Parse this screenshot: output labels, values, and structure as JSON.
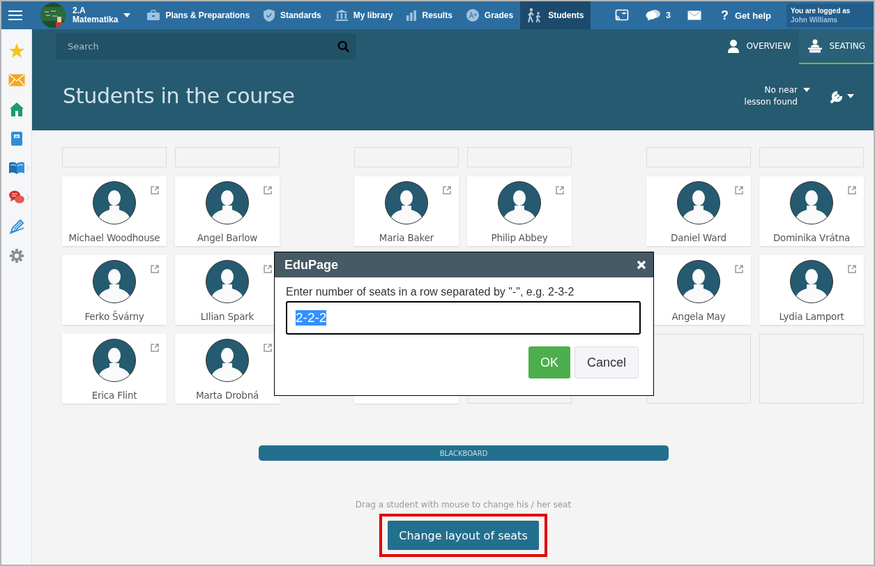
{
  "nav": {
    "class_name": "2.A",
    "subject": "Matematika",
    "items": [
      {
        "label": "Plans & Preparations",
        "selected": false
      },
      {
        "label": "Standards",
        "selected": false
      },
      {
        "label": "My library",
        "selected": false
      },
      {
        "label": "Results",
        "selected": false
      },
      {
        "label": "Grades",
        "selected": false
      },
      {
        "label": "Students",
        "selected": true
      }
    ],
    "chat_count": "3",
    "help": {
      "symbol": "?",
      "label": "Get help"
    },
    "user": {
      "caption": "You are logged as",
      "name": "John Williams"
    }
  },
  "sidebar": {
    "items": [
      {
        "submenu": false
      },
      {
        "submenu": false
      },
      {
        "submenu": false
      },
      {
        "submenu": false
      },
      {
        "submenu": true
      },
      {
        "submenu": true
      },
      {
        "submenu": false
      },
      {
        "submenu": false
      }
    ]
  },
  "search": {
    "placeholder": "Search"
  },
  "view_tabs": [
    {
      "label": "OVERVIEW",
      "selected": false
    },
    {
      "label": "SEATING",
      "selected": true
    }
  ],
  "title": "Students in the course",
  "lesson_picker": {
    "label": "No near lesson found"
  },
  "seating": {
    "rows": [
      [
        {
          "kind": "desk"
        },
        {
          "kind": "desk"
        },
        {
          "kind": "desk"
        },
        {
          "kind": "desk"
        },
        {
          "kind": "desk"
        },
        {
          "kind": "desk"
        }
      ],
      [
        {
          "kind": "student",
          "name": "Michael Woodhouse"
        },
        {
          "kind": "student",
          "name": "Angel Barlow"
        },
        {
          "kind": "student",
          "name": "Maria Baker"
        },
        {
          "kind": "student",
          "name": "Philip Abbey"
        },
        {
          "kind": "student",
          "name": "Daniel Ward"
        },
        {
          "kind": "student",
          "name": "Dominika Vrátna"
        }
      ],
      [
        {
          "kind": "student",
          "name": "Ferko Švárny"
        },
        {
          "kind": "student",
          "name": "LIlian Spark"
        },
        {
          "kind": "covered"
        },
        {
          "kind": "covered"
        },
        {
          "kind": "student",
          "name": "Angela May"
        },
        {
          "kind": "student",
          "name": "Lydia Lamport"
        }
      ],
      [
        {
          "kind": "student",
          "name": "Erica Flint"
        },
        {
          "kind": "student",
          "name": "Marta Drobná"
        },
        {
          "kind": "student"
        },
        {
          "kind": "empty"
        },
        {
          "kind": "empty"
        },
        {
          "kind": "empty"
        }
      ]
    ]
  },
  "blackboard": "BLACKBOARD",
  "hint": "Drag a student with mouse to change his / her seat",
  "change_button": {
    "label": "Change layout of seats",
    "highlighted": true
  },
  "dialog": {
    "title": "EduPage",
    "prompt": "Enter number of seats in a row separated by \"-\", e.g. 2-3-2",
    "value": "2-2-2",
    "value_selected": true,
    "buttons": [
      {
        "label": "OK",
        "kind": "primary"
      },
      {
        "label": "Cancel",
        "kind": "secondary"
      }
    ]
  }
}
